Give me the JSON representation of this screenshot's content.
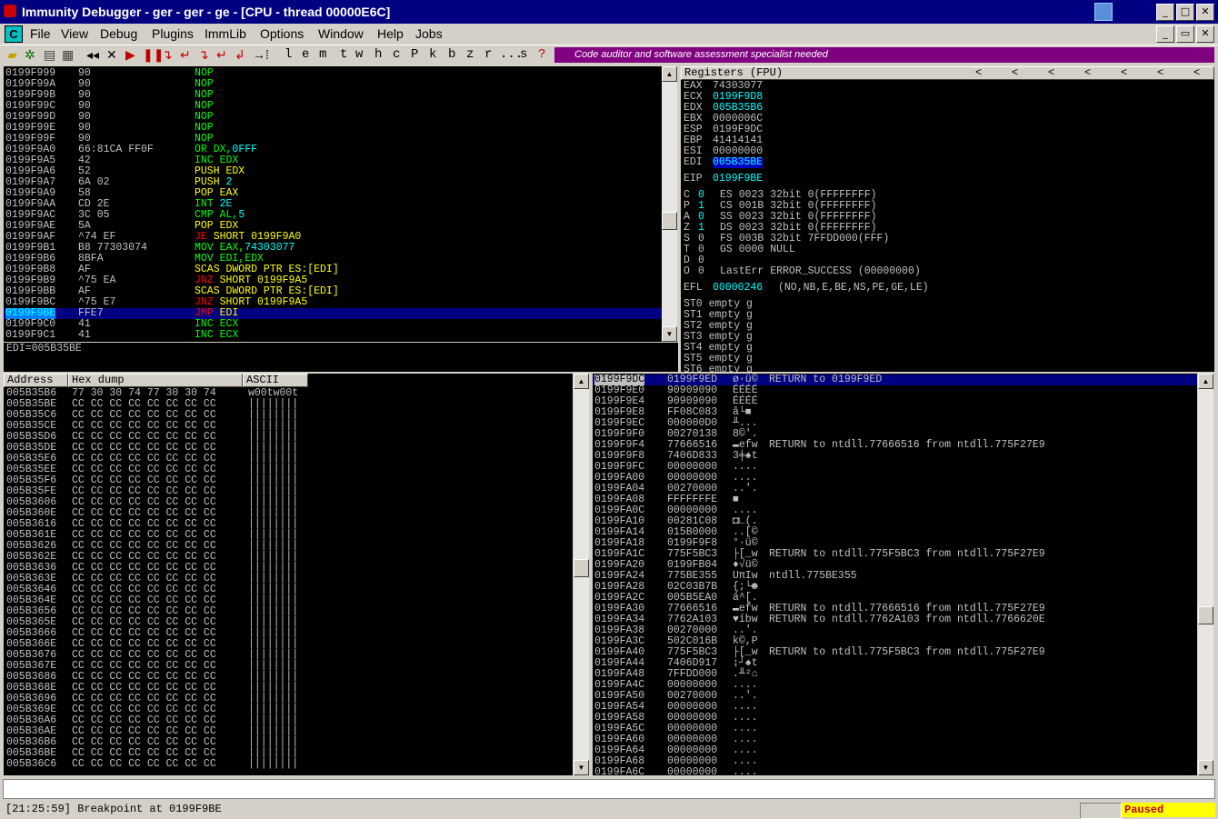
{
  "window": {
    "title": "Immunity Debugger - ger - ger - ge - [CPU - thread 00000E6C]"
  },
  "menu": [
    "File",
    "View",
    "Debug",
    "Plugins",
    "ImmLib",
    "Options",
    "Window",
    "Help",
    "Jobs"
  ],
  "toolbar": {
    "letters": [
      "l",
      "e",
      "m",
      "t",
      "w",
      "h",
      "c",
      "P",
      "k",
      "b",
      "z",
      "r",
      "...",
      "s",
      "?"
    ],
    "banner": "Code auditor and software assessment specialist needed"
  },
  "disasm": {
    "rows": [
      {
        "addr": "0199F999",
        "hex": "90",
        "instr": "NOP",
        "color": "g"
      },
      {
        "addr": "0199F99A",
        "hex": "90",
        "instr": "NOP",
        "color": "g"
      },
      {
        "addr": "0199F99B",
        "hex": "90",
        "instr": "NOP",
        "color": "g"
      },
      {
        "addr": "0199F99C",
        "hex": "90",
        "instr": "NOP",
        "color": "g"
      },
      {
        "addr": "0199F99D",
        "hex": "90",
        "instr": "NOP",
        "color": "g"
      },
      {
        "addr": "0199F99E",
        "hex": "90",
        "instr": "NOP",
        "color": "g"
      },
      {
        "addr": "0199F99F",
        "hex": "90",
        "instr": "NOP",
        "color": "g"
      },
      {
        "addr": "0199F9A0",
        "hex": "66:81CA FF0F",
        "instr": "OR DX,",
        "arg": "0FFF",
        "color": "g"
      },
      {
        "addr": "0199F9A5",
        "hex": "42",
        "instr": "INC EDX",
        "color": "g"
      },
      {
        "addr": "0199F9A6",
        "hex": "52",
        "instr": "PUSH EDX",
        "color": "y"
      },
      {
        "addr": "0199F9A7",
        "hex": "6A 02",
        "instr": "PUSH ",
        "arg": "2",
        "color": "y"
      },
      {
        "addr": "0199F9A9",
        "hex": "58",
        "instr": "POP EAX",
        "color": "y"
      },
      {
        "addr": "0199F9AA",
        "hex": "CD 2E",
        "instr": "INT ",
        "arg": "2E",
        "color": "g"
      },
      {
        "addr": "0199F9AC",
        "hex": "3C 05",
        "instr": "CMP AL,",
        "arg": "5",
        "color": "g"
      },
      {
        "addr": "0199F9AE",
        "hex": "5A",
        "instr": "POP EDX",
        "color": "y"
      },
      {
        "addr": "0199F9AF",
        "hex": "^74 EF",
        "instr": "JE SHORT 0199F9A0",
        "color": "y",
        "jmp": true
      },
      {
        "addr": "0199F9B1",
        "hex": "B8 77303074",
        "instr": "MOV EAX,",
        "arg": "74303077",
        "color": "g"
      },
      {
        "addr": "0199F9B6",
        "hex": "8BFA",
        "instr": "MOV EDI,EDX",
        "color": "g"
      },
      {
        "addr": "0199F9B8",
        "hex": "AF",
        "instr": "SCAS DWORD PTR ES:[EDI]",
        "color": "y"
      },
      {
        "addr": "0199F9B9",
        "hex": "^75 EA",
        "instr": "JNZ SHORT 0199F9A5",
        "color": "y",
        "jmp": true
      },
      {
        "addr": "0199F9BB",
        "hex": "AF",
        "instr": "SCAS DWORD PTR ES:[EDI]",
        "color": "y"
      },
      {
        "addr": "0199F9BC",
        "hex": "^75 E7",
        "instr": "JNZ SHORT 0199F9A5",
        "color": "y",
        "jmp": true
      },
      {
        "addr": "0199F9BE",
        "hex": "FFE7",
        "instr": "JMP EDI",
        "color": "y",
        "jmp": true,
        "selected": true
      },
      {
        "addr": "0199F9C0",
        "hex": "41",
        "instr": "INC ECX",
        "color": "g"
      },
      {
        "addr": "0199F9C1",
        "hex": "41",
        "instr": "INC ECX",
        "color": "g"
      }
    ],
    "info": "EDI=005B35BE"
  },
  "registers": {
    "header": "Registers (FPU)",
    "nav": [
      "<",
      "<",
      "<",
      "<",
      "<",
      "<",
      "<"
    ],
    "gp": [
      {
        "name": "EAX",
        "value": "74303077",
        "hl": false
      },
      {
        "name": "ECX",
        "value": "0199F9D8",
        "hl": true
      },
      {
        "name": "EDX",
        "value": "005B35B6",
        "hl": true
      },
      {
        "name": "EBX",
        "value": "0000006C",
        "hl": false
      },
      {
        "name": "ESP",
        "value": "0199F9DC",
        "hl": false
      },
      {
        "name": "EBP",
        "value": "41414141",
        "hl": false
      },
      {
        "name": "ESI",
        "value": "00000000",
        "hl": false
      },
      {
        "name": "EDI",
        "value": "005B35BE",
        "hl": true,
        "sel": true
      }
    ],
    "eip": {
      "name": "EIP",
      "value": "0199F9BE"
    },
    "flags": [
      {
        "f": "C",
        "v": "0",
        "seg": "ES 0023 32bit 0(FFFFFFFF)"
      },
      {
        "f": "P",
        "v": "1",
        "seg": "CS 001B 32bit 0(FFFFFFFF)"
      },
      {
        "f": "A",
        "v": "0",
        "seg": "SS 0023 32bit 0(FFFFFFFF)"
      },
      {
        "f": "Z",
        "v": "1",
        "seg": "DS 0023 32bit 0(FFFFFFFF)"
      },
      {
        "f": "S",
        "v": "0",
        "seg": "FS 003B 32bit 7FFDD000(FFF)"
      },
      {
        "f": "T",
        "v": "0",
        "seg": "GS 0000 NULL"
      },
      {
        "f": "D",
        "v": "0",
        "seg": ""
      },
      {
        "f": "O",
        "v": "0",
        "seg": "LastErr ERROR_SUCCESS (00000000)"
      }
    ],
    "efl": {
      "name": "EFL",
      "value": "00000246",
      "desc": "(NO,NB,E,BE,NS,PE,GE,LE)"
    },
    "fpu": [
      "ST0 empty g",
      "ST1 empty g",
      "ST2 empty g",
      "ST3 empty g",
      "ST4 empty g",
      "ST5 empty g",
      "ST6 empty g"
    ]
  },
  "dump": {
    "headers": [
      "Address",
      "Hex dump",
      "ASCII"
    ],
    "rows": [
      {
        "addr": "005B35B6",
        "hex": "77 30 30 74 77 30 30 74",
        "ascii": "w00tw00t"
      },
      {
        "addr": "005B35BE",
        "hex": "CC CC CC CC CC CC CC CC",
        "ascii": "||||||||"
      },
      {
        "addr": "005B35C6",
        "hex": "CC CC CC CC CC CC CC CC",
        "ascii": "||||||||"
      },
      {
        "addr": "005B35CE",
        "hex": "CC CC CC CC CC CC CC CC",
        "ascii": "||||||||"
      },
      {
        "addr": "005B35D6",
        "hex": "CC CC CC CC CC CC CC CC",
        "ascii": "||||||||"
      },
      {
        "addr": "005B35DE",
        "hex": "CC CC CC CC CC CC CC CC",
        "ascii": "||||||||"
      },
      {
        "addr": "005B35E6",
        "hex": "CC CC CC CC CC CC CC CC",
        "ascii": "||||||||"
      },
      {
        "addr": "005B35EE",
        "hex": "CC CC CC CC CC CC CC CC",
        "ascii": "||||||||"
      },
      {
        "addr": "005B35F6",
        "hex": "CC CC CC CC CC CC CC CC",
        "ascii": "||||||||"
      },
      {
        "addr": "005B35FE",
        "hex": "CC CC CC CC CC CC CC CC",
        "ascii": "||||||||"
      },
      {
        "addr": "005B3606",
        "hex": "CC CC CC CC CC CC CC CC",
        "ascii": "||||||||"
      },
      {
        "addr": "005B360E",
        "hex": "CC CC CC CC CC CC CC CC",
        "ascii": "||||||||"
      },
      {
        "addr": "005B3616",
        "hex": "CC CC CC CC CC CC CC CC",
        "ascii": "||||||||"
      },
      {
        "addr": "005B361E",
        "hex": "CC CC CC CC CC CC CC CC",
        "ascii": "||||||||"
      },
      {
        "addr": "005B3626",
        "hex": "CC CC CC CC CC CC CC CC",
        "ascii": "||||||||"
      },
      {
        "addr": "005B362E",
        "hex": "CC CC CC CC CC CC CC CC",
        "ascii": "||||||||"
      },
      {
        "addr": "005B3636",
        "hex": "CC CC CC CC CC CC CC CC",
        "ascii": "||||||||"
      },
      {
        "addr": "005B363E",
        "hex": "CC CC CC CC CC CC CC CC",
        "ascii": "||||||||"
      },
      {
        "addr": "005B3646",
        "hex": "CC CC CC CC CC CC CC CC",
        "ascii": "||||||||"
      },
      {
        "addr": "005B364E",
        "hex": "CC CC CC CC CC CC CC CC",
        "ascii": "||||||||"
      },
      {
        "addr": "005B3656",
        "hex": "CC CC CC CC CC CC CC CC",
        "ascii": "||||||||"
      },
      {
        "addr": "005B365E",
        "hex": "CC CC CC CC CC CC CC CC",
        "ascii": "||||||||"
      },
      {
        "addr": "005B3666",
        "hex": "CC CC CC CC CC CC CC CC",
        "ascii": "||||||||"
      },
      {
        "addr": "005B366E",
        "hex": "CC CC CC CC CC CC CC CC",
        "ascii": "||||||||"
      },
      {
        "addr": "005B3676",
        "hex": "CC CC CC CC CC CC CC CC",
        "ascii": "||||||||"
      },
      {
        "addr": "005B367E",
        "hex": "CC CC CC CC CC CC CC CC",
        "ascii": "||||||||"
      },
      {
        "addr": "005B3686",
        "hex": "CC CC CC CC CC CC CC CC",
        "ascii": "||||||||"
      },
      {
        "addr": "005B368E",
        "hex": "CC CC CC CC CC CC CC CC",
        "ascii": "||||||||"
      },
      {
        "addr": "005B3696",
        "hex": "CC CC CC CC CC CC CC CC",
        "ascii": "||||||||"
      },
      {
        "addr": "005B369E",
        "hex": "CC CC CC CC CC CC CC CC",
        "ascii": "||||||||"
      },
      {
        "addr": "005B36A6",
        "hex": "CC CC CC CC CC CC CC CC",
        "ascii": "||||||||"
      },
      {
        "addr": "005B36AE",
        "hex": "CC CC CC CC CC CC CC CC",
        "ascii": "||||||||"
      },
      {
        "addr": "005B36B6",
        "hex": "CC CC CC CC CC CC CC CC",
        "ascii": "||||||||"
      },
      {
        "addr": "005B36BE",
        "hex": "CC CC CC CC CC CC CC CC",
        "ascii": "||||||||"
      },
      {
        "addr": "005B36C6",
        "hex": "CC CC CC CC CC CC CC CC",
        "ascii": "||||||||"
      }
    ]
  },
  "stack": {
    "rows": [
      {
        "addr": "0199F9DC",
        "val": "0199F9ED",
        "asc": "ø·ü©",
        "cmt": "RETURN to 0199F9ED",
        "sel": true
      },
      {
        "addr": "0199F9E0",
        "val": "90909090",
        "asc": "ÉÉÉÉ",
        "cmt": ""
      },
      {
        "addr": "0199F9E4",
        "val": "90909090",
        "asc": "ÉÉÉÉ",
        "cmt": ""
      },
      {
        "addr": "0199F9E8",
        "val": "FF08C083",
        "asc": "â└■",
        "cmt": ""
      },
      {
        "addr": "0199F9EC",
        "val": "000000D0",
        "asc": "╨...",
        "cmt": ""
      },
      {
        "addr": "0199F9F0",
        "val": "00270138",
        "asc": "8©'.",
        "cmt": ""
      },
      {
        "addr": "0199F9F4",
        "val": "77666516",
        "asc": "▬efw",
        "cmt": "RETURN to ntdll.77666516 from ntdll.775F27E9"
      },
      {
        "addr": "0199F9F8",
        "val": "7406D833",
        "asc": "3╪♠t",
        "cmt": ""
      },
      {
        "addr": "0199F9FC",
        "val": "00000000",
        "asc": "....",
        "cmt": ""
      },
      {
        "addr": "0199FA00",
        "val": "00000000",
        "asc": "....",
        "cmt": ""
      },
      {
        "addr": "0199FA04",
        "val": "00270000",
        "asc": "..'.",
        "cmt": ""
      },
      {
        "addr": "0199FA08",
        "val": "FFFFFFFE",
        "asc": "■",
        "cmt": ""
      },
      {
        "addr": "0199FA0C",
        "val": "00000000",
        "asc": "....",
        "cmt": ""
      },
      {
        "addr": "0199FA10",
        "val": "00281C08",
        "asc": "◘∟(.",
        "cmt": ""
      },
      {
        "addr": "0199FA14",
        "val": "015B0000",
        "asc": "..[©",
        "cmt": ""
      },
      {
        "addr": "0199FA18",
        "val": "0199F9F8",
        "asc": "°·ü©",
        "cmt": ""
      },
      {
        "addr": "0199FA1C",
        "val": "775F5BC3",
        "asc": "├[_w",
        "cmt": "RETURN to ntdll.775F5BC3 from ntdll.775F27E9"
      },
      {
        "addr": "0199FA20",
        "val": "0199FB04",
        "asc": "♦√ü©",
        "cmt": ""
      },
      {
        "addr": "0199FA24",
        "val": "775BE355",
        "asc": "UπIw",
        "cmt": "ntdll.775BE355"
      },
      {
        "addr": "0199FA28",
        "val": "02C03B7B",
        "asc": "{;└☻",
        "cmt": ""
      },
      {
        "addr": "0199FA2C",
        "val": "005B5EA0",
        "asc": "á^[.",
        "cmt": ""
      },
      {
        "addr": "0199FA30",
        "val": "77666516",
        "asc": "▬efw",
        "cmt": "RETURN to ntdll.77666516 from ntdll.775F27E9"
      },
      {
        "addr": "0199FA34",
        "val": "7762A103",
        "asc": "♥íbw",
        "cmt": "RETURN to ntdll.7762A103 from ntdll.7766620E"
      },
      {
        "addr": "0199FA38",
        "val": "00270000",
        "asc": "..'.",
        "cmt": ""
      },
      {
        "addr": "0199FA3C",
        "val": "502C016B",
        "asc": "k©,P",
        "cmt": ""
      },
      {
        "addr": "0199FA40",
        "val": "775F5BC3",
        "asc": "├[_w",
        "cmt": "RETURN to ntdll.775F5BC3 from ntdll.775F27E9"
      },
      {
        "addr": "0199FA44",
        "val": "7406D917",
        "asc": "↨┘♠t",
        "cmt": ""
      },
      {
        "addr": "0199FA48",
        "val": "7FFDD000",
        "asc": ".╨²⌂",
        "cmt": ""
      },
      {
        "addr": "0199FA4C",
        "val": "00000000",
        "asc": "....",
        "cmt": ""
      },
      {
        "addr": "0199FA50",
        "val": "00270000",
        "asc": "..'.",
        "cmt": ""
      },
      {
        "addr": "0199FA54",
        "val": "00000000",
        "asc": "....",
        "cmt": ""
      },
      {
        "addr": "0199FA58",
        "val": "00000000",
        "asc": "....",
        "cmt": ""
      },
      {
        "addr": "0199FA5C",
        "val": "00000000",
        "asc": "....",
        "cmt": ""
      },
      {
        "addr": "0199FA60",
        "val": "00000000",
        "asc": "....",
        "cmt": ""
      },
      {
        "addr": "0199FA64",
        "val": "00000000",
        "asc": "....",
        "cmt": ""
      },
      {
        "addr": "0199FA68",
        "val": "00000000",
        "asc": "....",
        "cmt": ""
      },
      {
        "addr": "0199FA6C",
        "val": "00000000",
        "asc": "....",
        "cmt": ""
      }
    ]
  },
  "status": {
    "message": "[21:25:59] Breakpoint at 0199F9BE",
    "state": "Paused"
  }
}
